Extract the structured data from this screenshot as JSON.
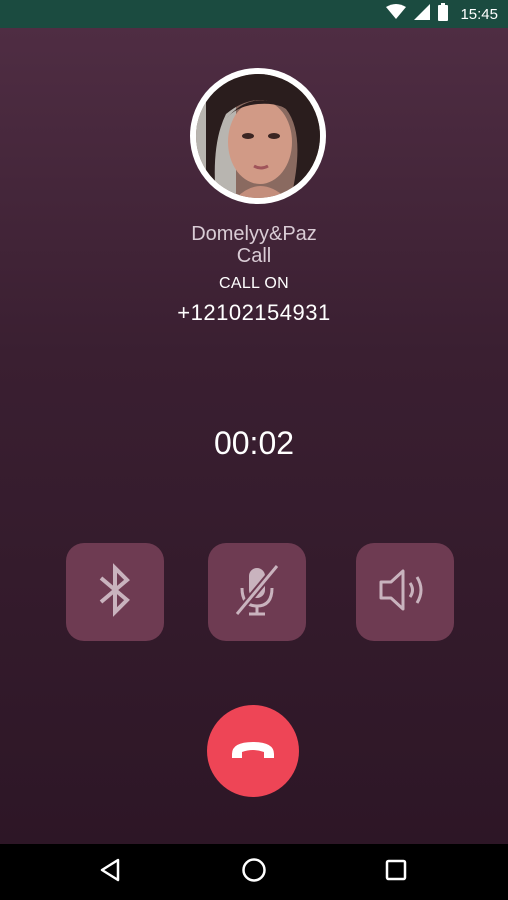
{
  "status_bar": {
    "time": "15:45",
    "icons": [
      "wifi-icon",
      "signal-icon",
      "battery-icon"
    ]
  },
  "contact": {
    "name": "Domelyy&Paz",
    "subtitle": "Call",
    "call_on_label": "CALL ON",
    "number": "+12102154931",
    "avatar": "avatar-photo"
  },
  "call": {
    "duration": "00:02"
  },
  "controls": [
    {
      "name": "bluetooth",
      "icon": "bluetooth-icon"
    },
    {
      "name": "mute",
      "icon": "mic-off-icon"
    },
    {
      "name": "speaker",
      "icon": "speaker-icon"
    }
  ],
  "end_call": {
    "icon": "phone-hangup-icon",
    "color": "#ee4556"
  },
  "nav": [
    "back-icon",
    "home-icon",
    "recents-icon"
  ],
  "colors": {
    "status_bar": "#1b4b40",
    "background_top": "#4f2d43",
    "background_bottom": "#2d1626",
    "control_button": "#6e3b52"
  }
}
